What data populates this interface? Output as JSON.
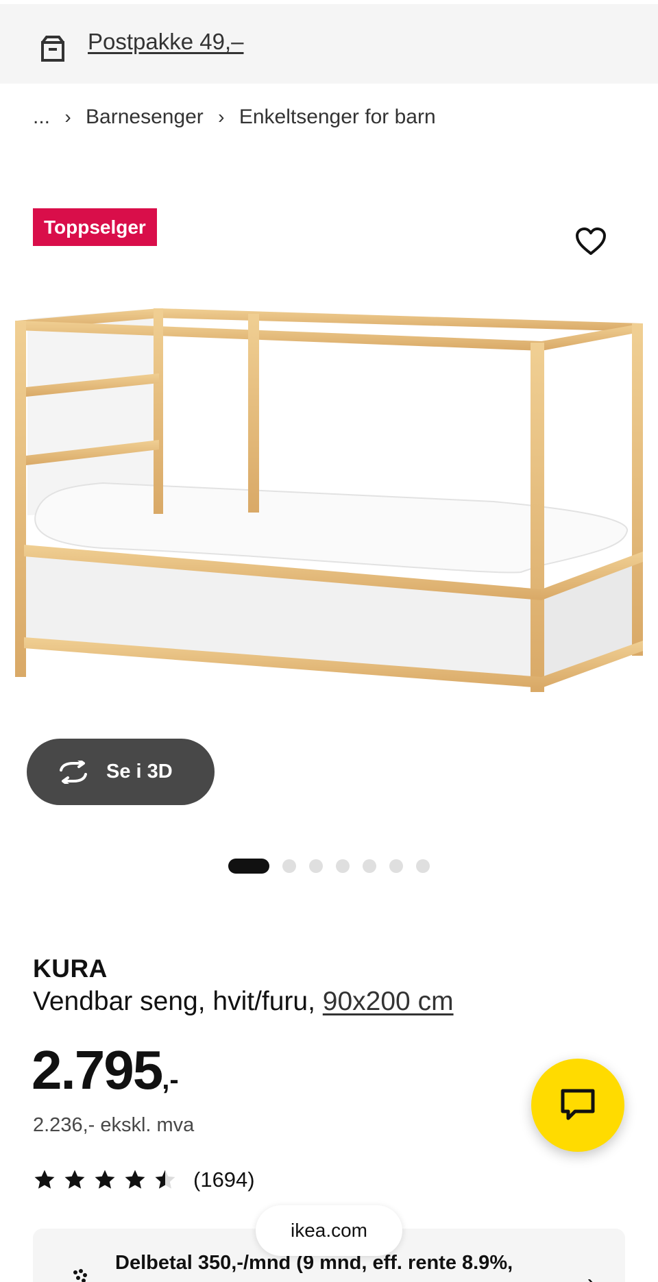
{
  "banner": {
    "icon": "package-icon",
    "text": "Postpakke 49,–"
  },
  "breadcrumb": {
    "items": [
      "...",
      "Barnesenger",
      "Enkeltsenger for barn"
    ],
    "separator": "›"
  },
  "badge": {
    "label": "Toppselger",
    "color": "#d90e4a"
  },
  "favorite": {
    "icon": "heart-icon"
  },
  "image": {
    "alt": "KURA reversible bed, white/pine"
  },
  "view3d": {
    "label": "Se i 3D",
    "icon": "rotate-3d-icon"
  },
  "carousel": {
    "count": 7,
    "active": 1
  },
  "product": {
    "name": "KURA",
    "description": "Vendbar seng, hvit/furu, ",
    "size": "90x200 cm",
    "price": "2.795",
    "price_suffix": ",-",
    "price_ex_vat": "2.236,- ekskl. mva",
    "rating": 4.5,
    "rating_max": 5,
    "reviews": "(1694)"
  },
  "chat": {
    "icon": "chat-icon",
    "color": "#ffdb00"
  },
  "finance": {
    "icon": "installment-icon",
    "text": "Delbetal 350,-/mnd (9 mnd, eff. rente 8.9%,"
  },
  "browser": {
    "url": "ikea.com"
  }
}
